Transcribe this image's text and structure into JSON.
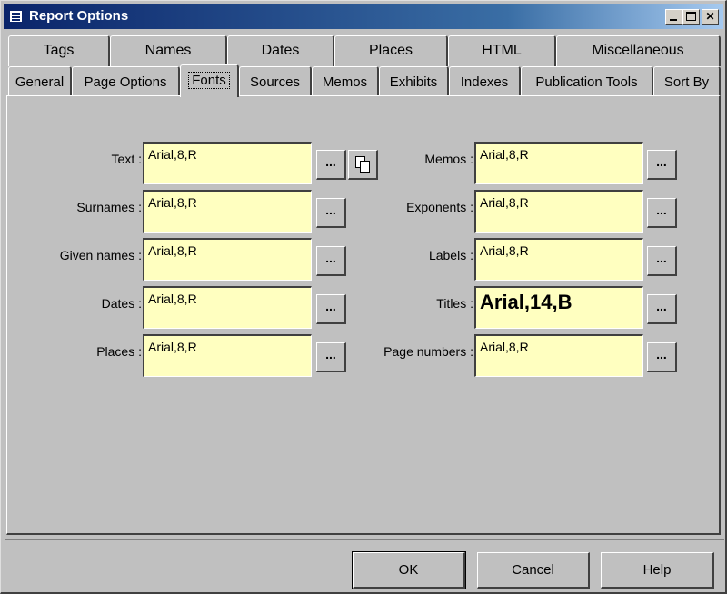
{
  "window": {
    "title": "Report Options",
    "title_buttons": {
      "minimize": "minimize",
      "maximize": "maximize",
      "close": "✕"
    }
  },
  "tabs_row1": [
    "Tags",
    "Names",
    "Dates",
    "Places",
    "HTML",
    "Miscellaneous"
  ],
  "tabs_row2": [
    "General",
    "Page Options",
    "Fonts",
    "Sources",
    "Memos",
    "Exhibits",
    "Indexes",
    "Publication Tools",
    "Sort By"
  ],
  "active_tab": "Fonts",
  "left_fields": [
    {
      "label": "Text :",
      "value": "Arial,8,R",
      "button": "..."
    },
    {
      "label": "Surnames :",
      "value": "Arial,8,R",
      "button": "..."
    },
    {
      "label": "Given names :",
      "value": "Arial,8,R",
      "button": "..."
    },
    {
      "label": "Dates :",
      "value": "Arial,8,R",
      "button": "..."
    },
    {
      "label": "Places :",
      "value": "Arial,8,R",
      "button": "..."
    }
  ],
  "right_fields": [
    {
      "label": "Memos :",
      "value": "Arial,8,R",
      "button": "..."
    },
    {
      "label": "Exponents :",
      "value": "Arial,8,R",
      "button": "..."
    },
    {
      "label": "Labels :",
      "value": "Arial,8,R",
      "button": "..."
    },
    {
      "label": "Titles :",
      "value": "Arial,14,B",
      "button": "..."
    },
    {
      "label": "Page numbers :",
      "value": "Arial,8,R",
      "button": "..."
    }
  ],
  "footer": {
    "ok": "OK",
    "cancel": "Cancel",
    "help": "Help"
  },
  "icons": {
    "app": "report-icon",
    "copy": "copy-icon"
  }
}
